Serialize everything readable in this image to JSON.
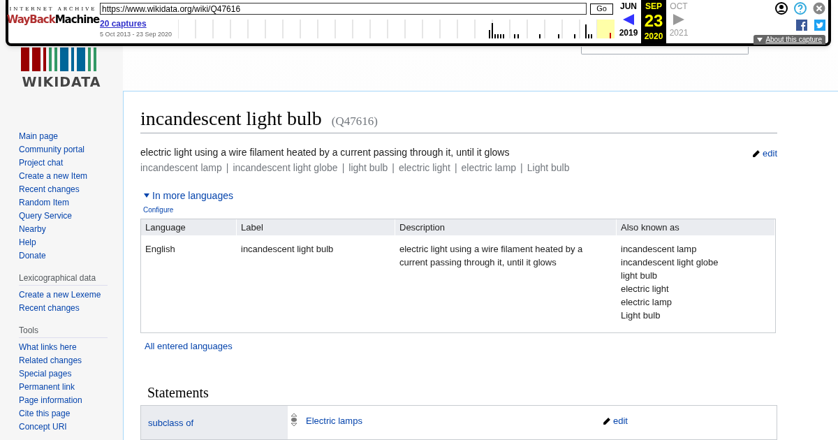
{
  "wayback": {
    "brand_top": "INTERNET ARCHIVE",
    "brand_a": "WayBack",
    "brand_b": "Machine",
    "url": "https://www.wikidata.org/wiki/Q47616",
    "go": "Go",
    "captures": "20 captures",
    "range": "5 Oct 2013 - 23 Sep 2020",
    "months": [
      {
        "label": "JUN",
        "year": "2019",
        "selected": false,
        "disabled": false
      },
      {
        "label": "SEP",
        "year": "2020",
        "selected": true,
        "disabled": false
      },
      {
        "label": "OCT",
        "year": "2021",
        "selected": false,
        "disabled": true
      }
    ],
    "day": "23",
    "about": "About this capture"
  },
  "logo": {
    "wordmark": "WIKIDATA"
  },
  "sidebar": {
    "sections": [
      {
        "items": [
          "Main page",
          "Community portal",
          "Project chat",
          "Create a new Item",
          "Recent changes",
          "Random Item",
          "Query Service",
          "Nearby",
          "Help",
          "Donate"
        ]
      },
      {
        "heading": "Lexicographical data",
        "items": [
          "Create a new Lexeme",
          "Recent changes"
        ]
      },
      {
        "heading": "Tools",
        "items": [
          "What links here",
          "Related changes",
          "Special pages",
          "Permanent link",
          "Page information",
          "Cite this page",
          "Concept URI"
        ]
      }
    ]
  },
  "page": {
    "title": "incandescent light bulb",
    "id": "(Q47616)",
    "description": "electric light using a wire filament heated by a current passing through it, until it glows",
    "edit": "edit",
    "aliases": [
      "incandescent lamp",
      "incandescent light globe",
      "light bulb",
      "electric light",
      "electric lamp",
      "Light bulb"
    ],
    "alias_separator": "|",
    "more_languages": "In more languages",
    "expanded": true,
    "configure": "Configure",
    "table": {
      "columns": [
        "Language",
        "Label",
        "Description",
        "Also known as"
      ],
      "rows": [
        {
          "language": "English",
          "label": "incandescent light bulb",
          "description": "electric light using a wire filament heated by a current passing through it, until it glows",
          "aliases": [
            "incandescent lamp",
            "incandescent light globe",
            "light bulb",
            "electric light",
            "electric lamp",
            "Light bulb"
          ]
        }
      ]
    },
    "all_languages": "All entered languages",
    "statements_heading": "Statements",
    "statements": [
      {
        "property": "subclass of",
        "value": "Electric lamps",
        "edit": "edit"
      }
    ]
  }
}
